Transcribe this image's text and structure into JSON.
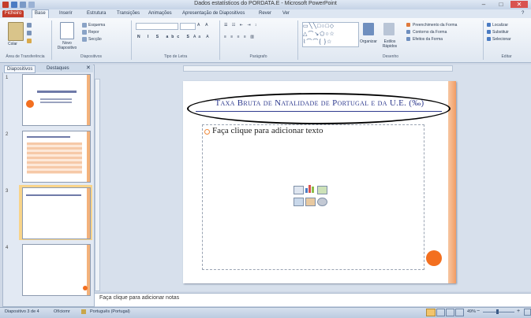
{
  "window": {
    "title": "Dados estatísticos do PORDATA.E - Microsoft PowerPoint"
  },
  "tabs": [
    "Ficheiro",
    "Base",
    "Inserir",
    "Estrutura",
    "Transições",
    "Animações",
    "Apresentação de Diapositivos",
    "Rever",
    "Ver"
  ],
  "ribbon": {
    "groups": [
      "Área de Transferência",
      "Diapositivos",
      "Tipo de Letra",
      "Parágrafo",
      "Desenho",
      "Editar"
    ],
    "paste_label": "Colar",
    "new_slide_label": "Novo Diapositivo",
    "layout_label": "Esquema",
    "reset_label": "Repor",
    "section_label": "Secção",
    "arrange_label": "Organizar",
    "quick_styles_label": "Estilos Rápidos",
    "shape_fill": "Preenchimento da Forma",
    "shape_outline": "Contorno da Forma",
    "shape_effects": "Efeitos da Forma",
    "find_label": "Localizar",
    "replace_label": "Substituir",
    "select_label": "Selecionar"
  },
  "panel": {
    "tabs": [
      "Diapositivos",
      "Destaques"
    ],
    "slide_numbers": [
      "1",
      "2",
      "3",
      "4"
    ]
  },
  "slide": {
    "title": "Taxa Bruta de Natalidade de Portugal e da U.E. (‰)",
    "content_placeholder": "Faça clique para adicionar texto"
  },
  "notes": {
    "placeholder": "Faça clique para adicionar notas"
  },
  "status": {
    "slide_info": "Diapositivo 3 de 4",
    "theme": "Ofíciomr",
    "language": "Português (Portugal)",
    "zoom": "49%"
  },
  "colors": {
    "accent_orange": "#f36f1f",
    "title_blue": "#2f3b8f",
    "file_tab": "#c43c2a"
  }
}
